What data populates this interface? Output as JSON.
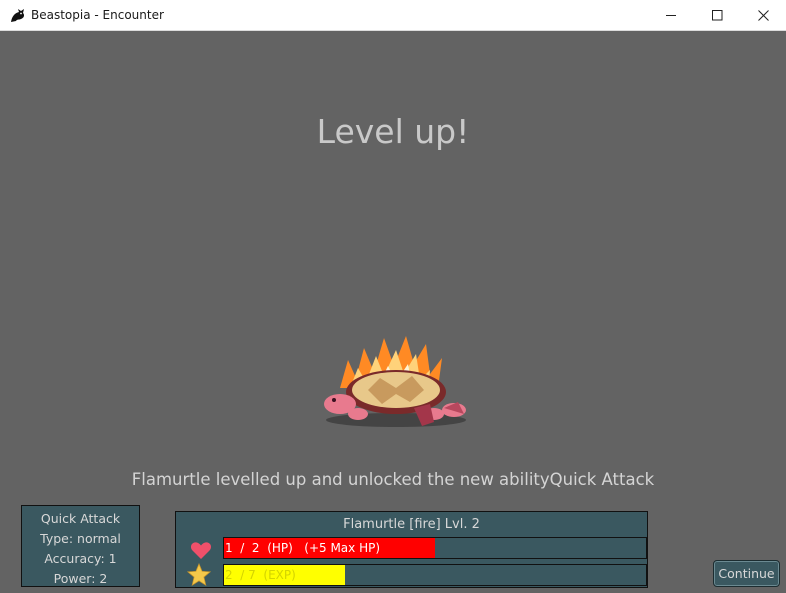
{
  "window": {
    "title": "Beastopia - Encounter",
    "app_icon": "dragon-logo-icon",
    "controls": [
      "minimize-icon",
      "maximize-icon",
      "close-icon"
    ]
  },
  "headline": "Level up!",
  "message": "Flamurtle levelled up and unlocked the new abilityQuick Attack",
  "ability": {
    "name": "Quick Attack",
    "type": "Type: normal",
    "accuracy": "Accuracy: 1",
    "power": "Power: 2"
  },
  "monster": {
    "title": "Flamurtle [fire] Lvl. 2",
    "hp": {
      "icon": "heart-icon",
      "text": "1  /  2  (HP)   (+5 Max HP)",
      "fill_fraction": 0.5,
      "color": "#ff0000",
      "text_color": "#ffffff"
    },
    "exp": {
      "icon": "star-icon",
      "text": "2  / 7  (EXP)",
      "fill_fraction": 0.2857,
      "color": "#ffff00",
      "text_color": "#d4d400"
    }
  },
  "buttons": {
    "continue": "Continue"
  },
  "colors": {
    "background": "#636363",
    "panel": "#3a5860"
  }
}
